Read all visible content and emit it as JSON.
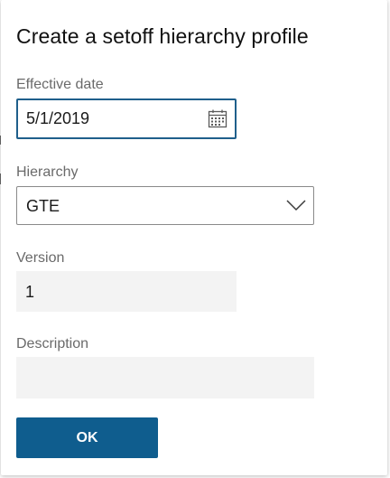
{
  "dialog": {
    "title": "Create a setoff hierarchy profile",
    "fields": {
      "effective_date": {
        "label": "Effective date",
        "value": "5/1/2019",
        "icon": "calendar-icon"
      },
      "hierarchy": {
        "label": "Hierarchy",
        "value": "GTE",
        "icon": "chevron-down-icon"
      },
      "version": {
        "label": "Version",
        "value": "1"
      },
      "description": {
        "label": "Description",
        "value": ""
      }
    },
    "ok_label": "OK"
  },
  "colors": {
    "accent": "#0f5d8e",
    "focus_border": "#1f5f8b",
    "readonly_fill": "#f3f3f3",
    "label_text": "#6a6a6a"
  }
}
